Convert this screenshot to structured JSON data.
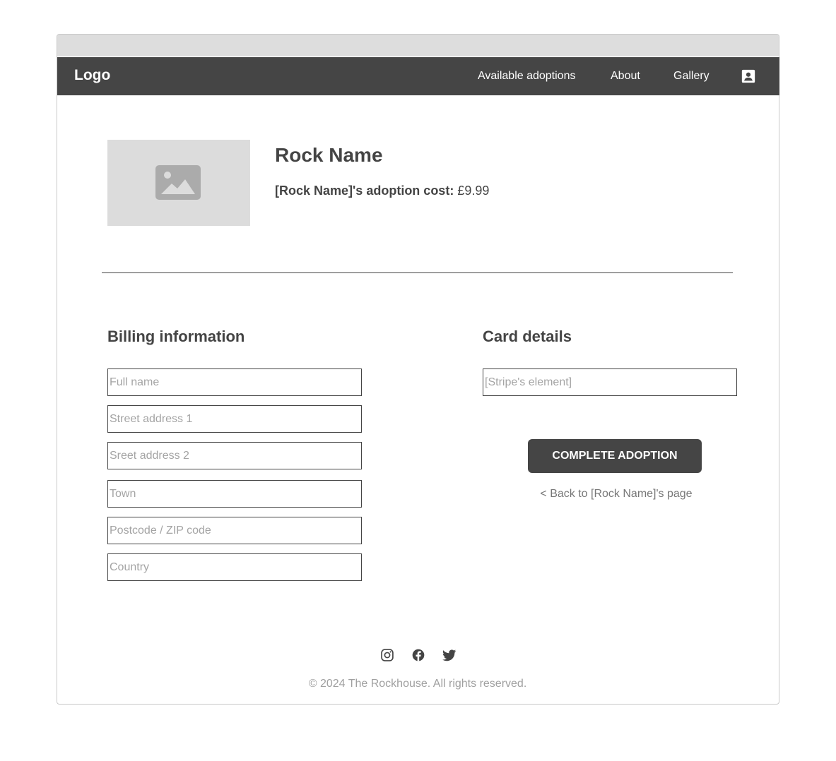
{
  "nav": {
    "logo": "Logo",
    "links": [
      "Available adoptions",
      "About",
      "Gallery"
    ],
    "account_icon": "account-box-icon"
  },
  "product": {
    "image_icon": "image-placeholder-icon",
    "name": "Rock Name",
    "cost_label": "[Rock Name]'s adoption cost:",
    "cost_value": "£9.99"
  },
  "billing": {
    "title": "Billing information",
    "fields": [
      {
        "placeholder": "Full name",
        "value": ""
      },
      {
        "placeholder": "Street address 1",
        "value": ""
      },
      {
        "placeholder": "Sreet address 2",
        "value": ""
      },
      {
        "placeholder": "Town",
        "value": ""
      },
      {
        "placeholder": "Postcode / ZIP code",
        "value": ""
      },
      {
        "placeholder": "Country",
        "value": ""
      }
    ]
  },
  "card": {
    "title": "Card details",
    "field_placeholder": "[Stripe's element]",
    "submit_label": "COMPLETE ADOPTION",
    "back_label": "< Back to [Rock Name]'s page"
  },
  "footer": {
    "social_icons": [
      "instagram-icon",
      "facebook-icon",
      "twitter-icon"
    ],
    "copyright": "© 2024 The Rockhouse. All rights reserved."
  },
  "colors": {
    "nav_bg": "#454545",
    "text": "#444444",
    "placeholder": "#a4a4a4",
    "image_bg": "#dcdcdc",
    "button_bg": "#454545"
  }
}
